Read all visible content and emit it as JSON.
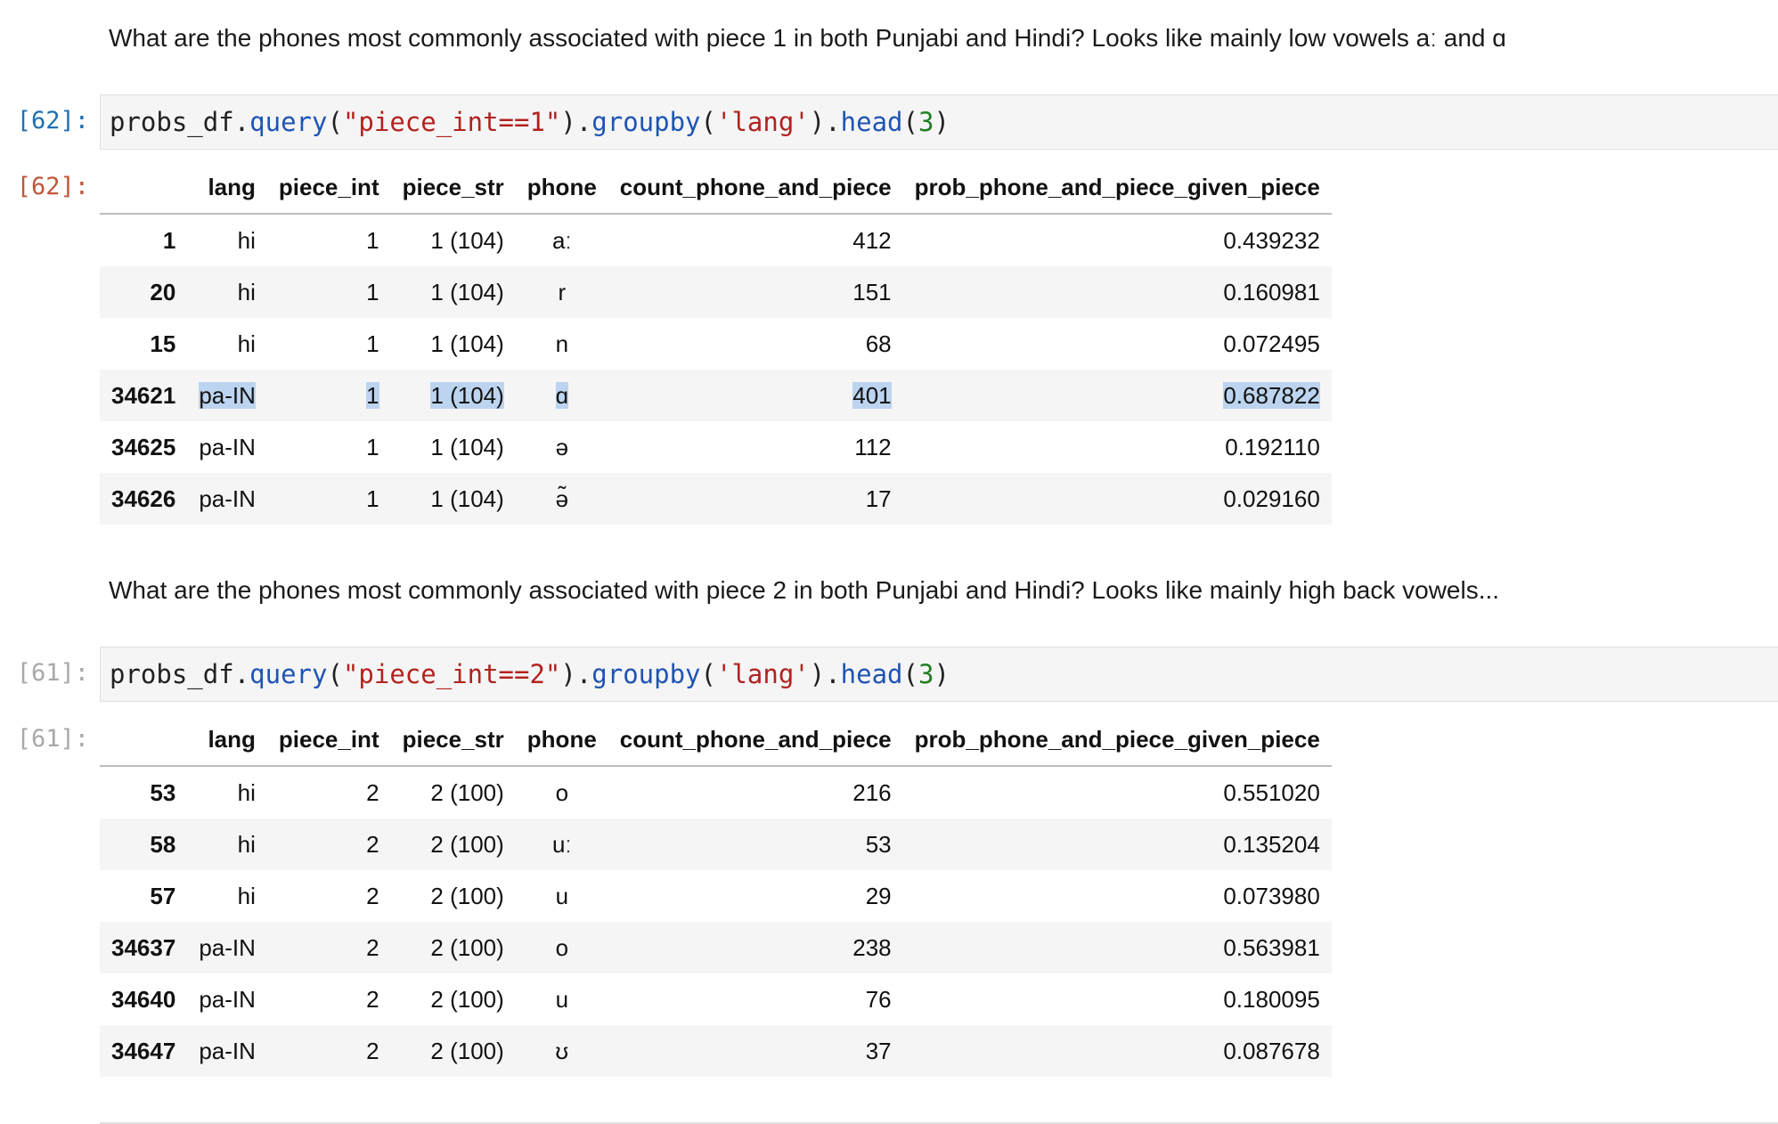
{
  "markdown": {
    "m1": "What are the phones most commonly associated with piece 1 in both Punjabi and Hindi? Looks like mainly low vowels aː and ɑ",
    "m2": "What are the phones most commonly associated with piece 2 in both Punjabi and Hindi? Looks like mainly high back vowels..."
  },
  "cells": [
    {
      "in_prompt": "[62]:",
      "out_prompt": "[62]:",
      "code_tokens": [
        {
          "t": "probs_df",
          "k": "var"
        },
        {
          "t": ".",
          "k": "op"
        },
        {
          "t": "query",
          "k": "fn"
        },
        {
          "t": "(",
          "k": "op"
        },
        {
          "t": "\"piece_int==1\"",
          "k": "str"
        },
        {
          "t": ").",
          "k": "op"
        },
        {
          "t": "groupby",
          "k": "fn"
        },
        {
          "t": "(",
          "k": "op"
        },
        {
          "t": "'lang'",
          "k": "str"
        },
        {
          "t": ").",
          "k": "op"
        },
        {
          "t": "head",
          "k": "fn"
        },
        {
          "t": "(",
          "k": "op"
        },
        {
          "t": "3",
          "k": "num"
        },
        {
          "t": ")",
          "k": "op"
        }
      ],
      "columns": [
        "",
        "lang",
        "piece_int",
        "piece_str",
        "phone",
        "count_phone_and_piece",
        "prob_phone_and_piece_given_piece"
      ],
      "rows": [
        {
          "idx": "1",
          "lang": "hi",
          "piece_int": "1",
          "piece_str": "1 (104)",
          "phone": "aː",
          "count": "412",
          "prob": "0.439232"
        },
        {
          "idx": "20",
          "lang": "hi",
          "piece_int": "1",
          "piece_str": "1 (104)",
          "phone": "r",
          "count": "151",
          "prob": "0.160981"
        },
        {
          "idx": "15",
          "lang": "hi",
          "piece_int": "1",
          "piece_str": "1 (104)",
          "phone": "n",
          "count": "68",
          "prob": "0.072495"
        },
        {
          "idx": "34621",
          "lang": "pa-IN",
          "piece_int": "1",
          "piece_str": "1 (104)",
          "phone": "ɑ",
          "count": "401",
          "prob": "0.687822",
          "selected": true
        },
        {
          "idx": "34625",
          "lang": "pa-IN",
          "piece_int": "1",
          "piece_str": "1 (104)",
          "phone": "ə",
          "count": "112",
          "prob": "0.192110"
        },
        {
          "idx": "34626",
          "lang": "pa-IN",
          "piece_int": "1",
          "piece_str": "1 (104)",
          "phone": "ə̃",
          "count": "17",
          "prob": "0.029160"
        }
      ]
    },
    {
      "in_prompt": "[61]:",
      "out_prompt": "[61]:",
      "code_tokens": [
        {
          "t": "probs_df",
          "k": "var"
        },
        {
          "t": ".",
          "k": "op"
        },
        {
          "t": "query",
          "k": "fn"
        },
        {
          "t": "(",
          "k": "op"
        },
        {
          "t": "\"piece_int==2\"",
          "k": "str"
        },
        {
          "t": ").",
          "k": "op"
        },
        {
          "t": "groupby",
          "k": "fn"
        },
        {
          "t": "(",
          "k": "op"
        },
        {
          "t": "'lang'",
          "k": "str"
        },
        {
          "t": ").",
          "k": "op"
        },
        {
          "t": "head",
          "k": "fn"
        },
        {
          "t": "(",
          "k": "op"
        },
        {
          "t": "3",
          "k": "num"
        },
        {
          "t": ")",
          "k": "op"
        }
      ],
      "columns": [
        "",
        "lang",
        "piece_int",
        "piece_str",
        "phone",
        "count_phone_and_piece",
        "prob_phone_and_piece_given_piece"
      ],
      "rows": [
        {
          "idx": "53",
          "lang": "hi",
          "piece_int": "2",
          "piece_str": "2 (100)",
          "phone": "o",
          "count": "216",
          "prob": "0.551020"
        },
        {
          "idx": "58",
          "lang": "hi",
          "piece_int": "2",
          "piece_str": "2 (100)",
          "phone": "uː",
          "count": "53",
          "prob": "0.135204"
        },
        {
          "idx": "57",
          "lang": "hi",
          "piece_int": "2",
          "piece_str": "2 (100)",
          "phone": "u",
          "count": "29",
          "prob": "0.073980"
        },
        {
          "idx": "34637",
          "lang": "pa-IN",
          "piece_int": "2",
          "piece_str": "2 (100)",
          "phone": "o",
          "count": "238",
          "prob": "0.563981"
        },
        {
          "idx": "34640",
          "lang": "pa-IN",
          "piece_int": "2",
          "piece_str": "2 (100)",
          "phone": "u",
          "count": "76",
          "prob": "0.180095"
        },
        {
          "idx": "34647",
          "lang": "pa-IN",
          "piece_int": "2",
          "piece_str": "2 (100)",
          "phone": "ʊ",
          "count": "37",
          "prob": "0.087678"
        }
      ]
    }
  ]
}
